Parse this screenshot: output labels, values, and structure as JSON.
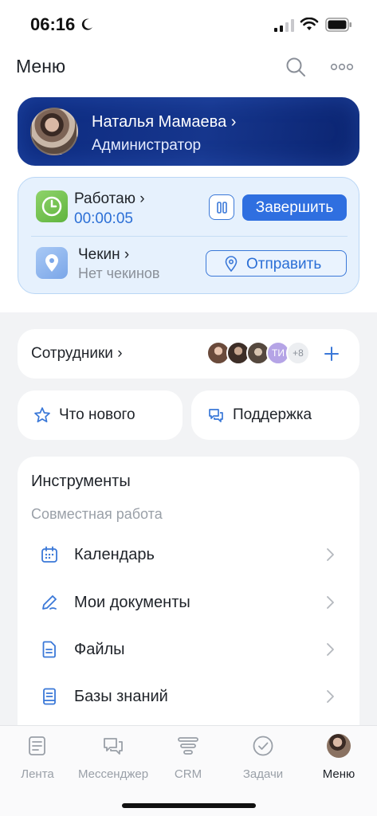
{
  "status_bar": {
    "time": "06:16"
  },
  "header": {
    "title": "Меню"
  },
  "profile": {
    "name": "Наталья Мамаева ›",
    "role": "Администратор"
  },
  "work": {
    "status_label": "Работаю ›",
    "timer": "00:00:05",
    "finish_label": "Завершить",
    "checkin_label": "Чекин ›",
    "checkin_sub": "Нет чекинов",
    "send_label": "Отправить"
  },
  "employees": {
    "label": "Сотрудники ›",
    "initials": "ТИ",
    "extra_count": "+8"
  },
  "quick_actions": {
    "whats_new": "Что нового",
    "support": "Поддержка"
  },
  "tools": {
    "title": "Инструменты",
    "subtitle": "Совместная работа",
    "items": [
      {
        "label": "Календарь",
        "icon": "calendar-icon"
      },
      {
        "label": "Мои документы",
        "icon": "pen-icon"
      },
      {
        "label": "Файлы",
        "icon": "file-icon"
      },
      {
        "label": "Базы знаний",
        "icon": "book-icon"
      }
    ]
  },
  "tabs": [
    {
      "label": "Лента",
      "icon": "feed-icon"
    },
    {
      "label": "Мессенджер",
      "icon": "chat-icon"
    },
    {
      "label": "CRM",
      "icon": "crm-icon"
    },
    {
      "label": "Задачи",
      "icon": "check-circle-icon"
    },
    {
      "label": "Меню",
      "icon": "avatar",
      "active": true
    }
  ],
  "colors": {
    "accent": "#2f6fe0",
    "profile_bg": "#16368d",
    "work_bg": "#e6f1fd"
  }
}
